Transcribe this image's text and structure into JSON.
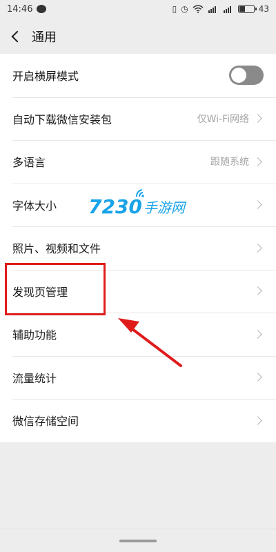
{
  "status": {
    "time": "14:46",
    "battery": "43",
    "battery_level": 0.43,
    "icons": [
      "chat-bubble-icon",
      "vibrate-icon",
      "alarm-icon",
      "wifi-icon",
      "signal-4g-icon",
      "signal-3g-icon",
      "battery-icon"
    ]
  },
  "nav": {
    "title": "通用"
  },
  "settings": [
    {
      "label": "开启横屏模式",
      "type": "toggle",
      "on": false
    },
    {
      "label": "自动下载微信安装包",
      "value": "仅Wi-Fi网络"
    },
    {
      "label": "多语言",
      "value": "跟随系统"
    },
    {
      "label": "字体大小",
      "value": ""
    },
    {
      "label": "照片、视频和文件",
      "value": ""
    },
    {
      "label": "发现页管理",
      "value": ""
    },
    {
      "label": "辅助功能",
      "value": ""
    },
    {
      "label": "流量统计",
      "value": ""
    },
    {
      "label": "微信存储空间",
      "value": ""
    }
  ],
  "watermark": {
    "number": "7230",
    "text": "手游网"
  },
  "colors": {
    "highlight": "#e01b1b",
    "watermark": "#1aa3e8",
    "toggle_off": "#8a8a8a"
  }
}
